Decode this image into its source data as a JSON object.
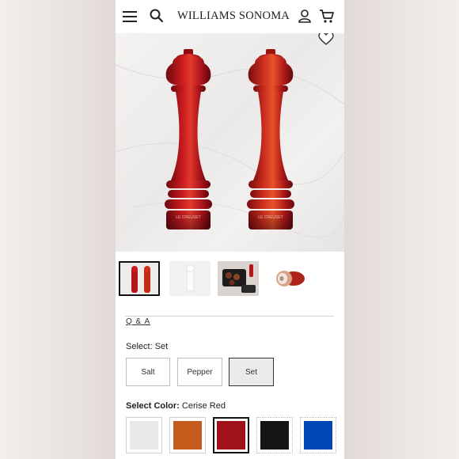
{
  "header": {
    "brand": "WILLIAMS SONOMA",
    "icons": [
      "menu-icon",
      "search-icon",
      "account-icon",
      "cart-icon"
    ]
  },
  "hero": {
    "product_logo_text": "LE CREUSET",
    "icons": [
      "heart-icon"
    ]
  },
  "thumbnails": [
    {
      "name": "red-pair",
      "selected": true
    },
    {
      "name": "white-mill",
      "selected": false
    },
    {
      "name": "kitchen-scene",
      "selected": false
    },
    {
      "name": "mill-closeup",
      "selected": false
    }
  ],
  "links": {
    "qa": "Q & A"
  },
  "select_option": {
    "label": "Select:",
    "value": "Set",
    "options": [
      {
        "label": "Salt",
        "selected": false
      },
      {
        "label": "Pepper",
        "selected": false
      },
      {
        "label": "Set",
        "selected": true
      }
    ]
  },
  "select_color": {
    "label": "Select Color:",
    "value": "Cerise Red",
    "swatches": [
      {
        "color": "#e9e9e9",
        "selected": false
      },
      {
        "color": "#c45a1c",
        "selected": false
      },
      {
        "color": "#a0111a",
        "selected": true
      },
      {
        "color": "#151515",
        "selected": false
      },
      {
        "color": "#0046b4",
        "selected": false
      }
    ]
  },
  "colors": {
    "mill_red": "#b8141c",
    "mill_orange_red": "#c42a14"
  }
}
